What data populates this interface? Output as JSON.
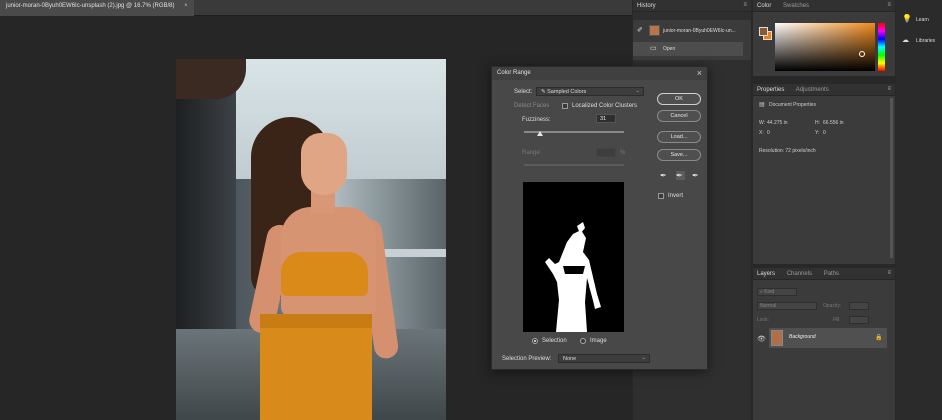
{
  "document": {
    "tab_title": "junior-moran-0Byuh0EW6Ic-unsplash (2).jpg @ 16.7% (RGB/8)",
    "tab_close": "×"
  },
  "history": {
    "title": "History",
    "snapshot_label": "junior-moran-0Byuh0EW6Ic-un...",
    "open_label": "Open"
  },
  "color_panel": {
    "tabs": [
      "Color",
      "Swatches"
    ],
    "foreground": "#8b5a2b",
    "background": "#e8801e"
  },
  "properties": {
    "tabs": [
      "Properties",
      "Adjustments"
    ],
    "doc_label": "Document Properties",
    "w_label": "W:",
    "w_value": "44.275 in",
    "h_label": "H:",
    "h_value": "66.556 in",
    "x_label": "X:",
    "x_value": "0",
    "y_label": "Y:",
    "y_value": "0",
    "resolution": "Resolution: 72 pixels/inch"
  },
  "layers": {
    "tabs": [
      "Layers",
      "Channels",
      "Paths"
    ],
    "kind_placeholder": "Kind",
    "blend_mode": "Normal",
    "opacity_label": "Opacity:",
    "lock_label": "Lock:",
    "fill_label": "Fill:",
    "layer_name": "Background"
  },
  "right_strip": {
    "learn": "Learn",
    "libraries": "Libraries"
  },
  "color_range": {
    "title": "Color Range",
    "close": "×",
    "select_label": "Select:",
    "select_value": "Sampled Colors",
    "detect_faces": "Detect Faces",
    "localized_clusters": "Localized Color Clusters",
    "fuzziness_label": "Fuzziness:",
    "fuzziness_value": "31",
    "fuzziness": 0.155,
    "range_label": "Range:",
    "range_unit": "%",
    "buttons": {
      "ok": "OK",
      "cancel": "Cancel",
      "load": "Load...",
      "save": "Save..."
    },
    "invert_label": "Invert",
    "selection_label": "Selection",
    "image_label": "Image",
    "preview_label": "Selection Preview:",
    "preview_value": "None"
  }
}
